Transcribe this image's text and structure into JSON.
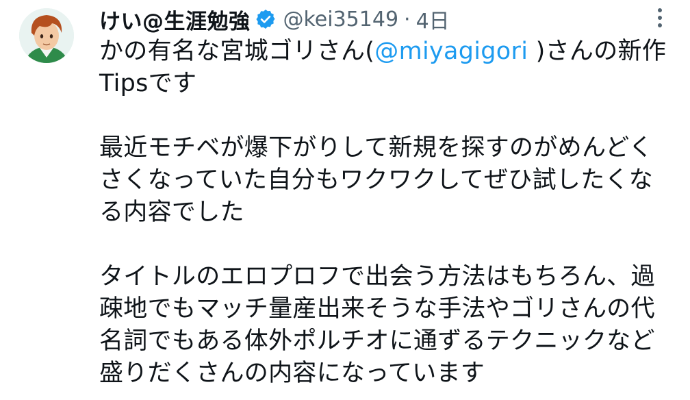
{
  "tweet": {
    "author_name": "けい@生涯勉強",
    "handle": "@kei35149",
    "separator": "·",
    "time": "4日",
    "lines": {
      "l1_pre": "かの有名な宮城ゴリさん(",
      "l1_mention": "@miyagigori",
      "l1_post": " )さんの新作",
      "l2": "Tipsです",
      "l3": "最近モチベが爆下がりして新規を探すのがめんどく",
      "l4": "さくなっていた自分もワクワクしてぜひ試したくな",
      "l5": "る内容でした",
      "l6": "タイトルのエロプロフで出会う方法はもちろん、過",
      "l7": "疎地でもマッチ量産出来そうな手法やゴリさんの代",
      "l8": "名詞でもある体外ポルチオに通ずるテクニックなど",
      "l9": "盛りだくさんの内容になっています"
    }
  },
  "icons": {
    "verified": "verified-badge-icon",
    "more": "more-dots-icon"
  },
  "colors": {
    "text": "#0f1419",
    "secondary": "#536471",
    "accent": "#1d9bf0"
  }
}
